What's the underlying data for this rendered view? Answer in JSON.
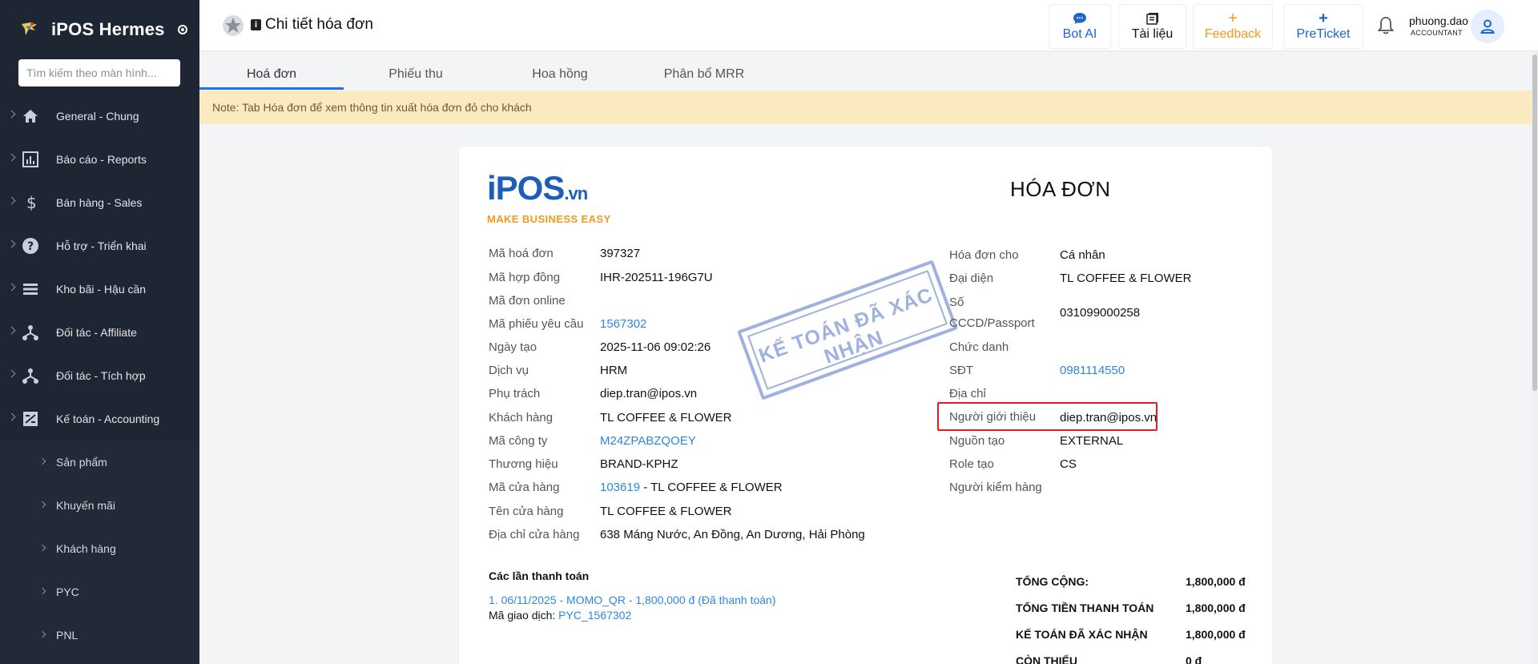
{
  "sidebar": {
    "brand": "iPOS Hermes",
    "search_placeholder": "Tìm kiếm theo màn hình...",
    "items": [
      {
        "label": "General - Chung",
        "icon": "home-icon"
      },
      {
        "label": "Báo cáo - Reports",
        "icon": "bar-chart-icon"
      },
      {
        "label": "Bán hàng - Sales",
        "icon": "dollar-icon"
      },
      {
        "label": "Hỗ trợ - Triển khai",
        "icon": "help-icon"
      },
      {
        "label": "Kho bãi - Hậu cần",
        "icon": "list-icon"
      },
      {
        "label": "Đối tác - Affiliate",
        "icon": "network-icon"
      },
      {
        "label": "Đối tác - Tích hợp",
        "icon": "network-icon"
      },
      {
        "label": "Kế toán - Accounting",
        "icon": "accounting-icon"
      }
    ],
    "subitems": [
      "Sản phẩm",
      "Khuyến mãi",
      "Khách hàng",
      "PYC",
      "PNL"
    ]
  },
  "header": {
    "title": "Chi tiết hóa đơn",
    "buttons": {
      "bot_ai": "Bot AI",
      "docs": "Tài liệu",
      "feedback": "Feedback",
      "preticket": "PreTicket"
    },
    "user_name": "phuong.dao",
    "user_role": "ACCOUNTANT"
  },
  "tabs": [
    "Hoá đơn",
    "Phiếu thu",
    "Hoa hồng",
    "Phân bổ MRR"
  ],
  "note": "Note: Tab Hóa đơn để xem thông tin xuất hóa đơn đỏ cho khách",
  "invoice": {
    "logo_main": "iPOS",
    "logo_suffix": ".vn",
    "logo_tagline": "MAKE BUSINESS EASY",
    "title": "HÓA ĐƠN",
    "stamp": "KẾ TOÁN ĐÃ XÁC NHẬN",
    "left": {
      "ma_hoa_don": {
        "label": "Mã hoá đơn",
        "value": "397327"
      },
      "ma_hop_dong": {
        "label": "Mã hợp đồng",
        "value": "IHR-202511-196G7U"
      },
      "ma_don_online": {
        "label": "Mã đơn online",
        "value": ""
      },
      "ma_phieu_yeu_cau": {
        "label": "Mã phiếu yêu cầu",
        "value": "1567302"
      },
      "ngay_tao": {
        "label": "Ngày tạo",
        "value": "2025-11-06 09:02:26"
      },
      "dich_vu": {
        "label": "Dịch vụ",
        "value": "HRM"
      },
      "phu_trach": {
        "label": "Phụ trách",
        "value": "diep.tran@ipos.vn"
      },
      "khach_hang": {
        "label": "Khách hàng",
        "value": "TL COFFEE & FLOWER"
      },
      "ma_cong_ty": {
        "label": "Mã công ty",
        "value": "M24ZPABZQOEY"
      },
      "thuong_hieu": {
        "label": "Thương hiệu",
        "value": "BRAND-KPHZ"
      },
      "ma_cua_hang": {
        "label": "Mã cửa hàng",
        "value": "103619",
        "suffix": " - TL COFFEE & FLOWER"
      },
      "ten_cua_hang": {
        "label": "Tên cửa hàng",
        "value": "TL COFFEE & FLOWER"
      },
      "dia_chi_cua_hang": {
        "label": "Địa chỉ cửa hàng",
        "value": "638 Máng Nước, An Đồng, An Dương, Hải Phòng"
      }
    },
    "right": {
      "hoa_don_cho": {
        "label": "Hóa đơn cho",
        "value": "Cá nhân"
      },
      "dai_dien": {
        "label": "Đại diện",
        "value": "TL COFFEE & FLOWER"
      },
      "so_cccd_1": {
        "label": "Số"
      },
      "so_cccd_2": {
        "label": "CCCD/Passport",
        "value": "031099000258"
      },
      "chuc_danh": {
        "label": "Chức danh",
        "value": ""
      },
      "sdt": {
        "label": "SĐT",
        "value": "0981114550"
      },
      "dia_chi": {
        "label": "Địa chỉ",
        "value": ""
      },
      "nguoi_gioi_thieu": {
        "label": "Người giới thiệu",
        "value": "diep.tran@ipos.vn"
      },
      "nguon_tao": {
        "label": "Nguồn tạo",
        "value": "EXTERNAL"
      },
      "role_tao": {
        "label": "Role tạo",
        "value": "CS"
      },
      "nguoi_kiem_hang": {
        "label": "Người kiểm hàng",
        "value": ""
      }
    },
    "payments": {
      "title": "Các lần thanh toán",
      "line": "1. 06/11/2025 - MOMO_QR - 1,800,000 đ (Đã thanh toán)",
      "code_label": "Mã giao dịch: ",
      "code_value": "PYC_1567302"
    },
    "totals": [
      {
        "label": "TỔNG CỘNG:",
        "value": "1,800,000 đ"
      },
      {
        "label": "TỔNG TIỀN THANH TOÁN",
        "value": "1,800,000 đ"
      },
      {
        "label": "KẾ TOÁN ĐÃ XÁC NHẬN",
        "value": "1,800,000 đ"
      },
      {
        "label": "CÒN THIẾU",
        "value": "0 đ"
      }
    ]
  },
  "colors": {
    "sidebar_bg": "#1f2633",
    "accent": "#1a73e8",
    "link": "#2f86e0",
    "feedback": "#f39a1e",
    "note_bg": "#fbe9bf",
    "highlight": "#e02020"
  }
}
